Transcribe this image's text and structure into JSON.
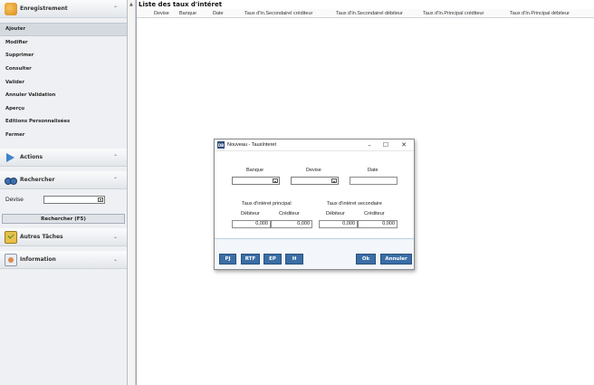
{
  "sidebar": {
    "enregistrement": {
      "label": "Enregistrement",
      "icon": "pen-icon",
      "items": [
        {
          "label": "Ajouter",
          "active": true
        },
        {
          "label": "Modifier"
        },
        {
          "label": "Supprimer"
        },
        {
          "label": "Consulter"
        },
        {
          "label": "Valider"
        },
        {
          "label": "Annuler Validation"
        },
        {
          "label": "Aperçu"
        },
        {
          "label": "Editions Personnalisées"
        },
        {
          "label": "Fermer"
        }
      ]
    },
    "actions": {
      "label": "Actions",
      "icon": "play-icon"
    },
    "rechercher": {
      "label": "Rechercher",
      "icon": "binoculars-icon",
      "devise_label": "Devise",
      "devise_value": "",
      "button_label": "Rechercher (F5)"
    },
    "autres_taches": {
      "label": "Autres Tâches",
      "icon": "tasks-icon"
    },
    "information": {
      "label": "Information",
      "icon": "info-icon"
    }
  },
  "main": {
    "title": "Liste des taux d'intéret",
    "columns": [
      "Devise",
      "Banque",
      "Date",
      "Taux d'In.Secondairel créditeur",
      "Taux d'In.Secondairel débiteur",
      "Taux d'In.Principal créditeur",
      "Taux d'In.Principal débiteur"
    ],
    "rows": []
  },
  "dialog": {
    "title": "Nouveau - TauxInteret",
    "app_icon_text": "DB",
    "labels": {
      "banque": "Banque",
      "devise": "Devise",
      "date": "Date",
      "principal_group": "Taux d'intéret principal",
      "secondaire_group": "Taux d'intéret secondaire",
      "debiteur1": "Débiteur",
      "crediteur1": "Créditeur",
      "debiteur2": "Débiteur",
      "crediteur2": "Créditeur"
    },
    "values": {
      "banque": "",
      "devise": "",
      "date": "",
      "principal_debiteur": "0,000",
      "principal_crediteur": "0,000",
      "secondaire_debiteur": "0,000",
      "secondaire_crediteur": "0,000"
    },
    "buttons": {
      "pj": "PJ",
      "rtf": "RTF",
      "ep": "EP",
      "h": "H",
      "ok": "Ok",
      "annuler": "Annuler"
    }
  },
  "colors": {
    "accent_button": "#3b6ea5",
    "sidebar_bg": "#eef0f3"
  }
}
